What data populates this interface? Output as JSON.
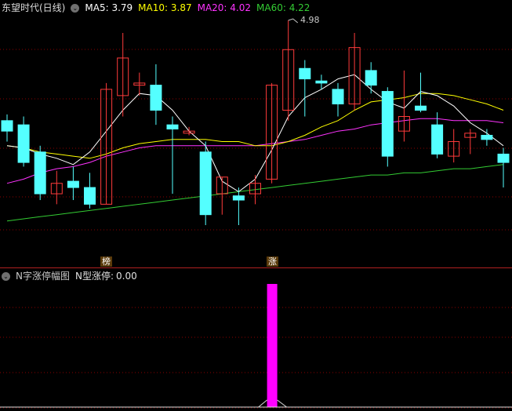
{
  "header": {
    "title": "东望时代(日线)",
    "ma5_label": "MA5:",
    "ma5_value": "3.79",
    "ma10_label": "MA10:",
    "ma10_value": "3.87",
    "ma20_label": "MA20:",
    "ma20_value": "4.02",
    "ma60_label": "MA60:",
    "ma60_value": "4.22"
  },
  "indicator": {
    "title": "N字涨停幅图",
    "value_label": "N型涨停:",
    "value": "0.00"
  },
  "annotations": {
    "high_price": "4.98",
    "badge_bang": "榜",
    "badge_zhang": "涨"
  },
  "colors": {
    "up": "#ff3b3b",
    "down": "#54ffff",
    "ma5": "#ffffff",
    "ma10": "#ffff00",
    "ma20": "#ff33ff",
    "ma60": "#33cc33",
    "bar": "#ff00ff",
    "grid": "#8b0000",
    "divider": "#b02020"
  },
  "chart_data": [
    {
      "type": "candlestick",
      "title": "东望时代(日线)",
      "candles": [
        {
          "o": 4.5,
          "h": 4.53,
          "l": 4.4,
          "c": 4.45
        },
        {
          "o": 4.48,
          "h": 4.52,
          "l": 4.28,
          "c": 4.3
        },
        {
          "o": 4.35,
          "h": 4.38,
          "l": 4.12,
          "c": 4.15
        },
        {
          "o": 4.15,
          "h": 4.26,
          "l": 4.1,
          "c": 4.2
        },
        {
          "o": 4.21,
          "h": 4.28,
          "l": 4.12,
          "c": 4.18
        },
        {
          "o": 4.18,
          "h": 4.25,
          "l": 4.08,
          "c": 4.1
        },
        {
          "o": 4.1,
          "h": 4.68,
          "l": 4.1,
          "c": 4.65
        },
        {
          "o": 4.62,
          "h": 4.92,
          "l": 4.52,
          "c": 4.8
        },
        {
          "o": 4.67,
          "h": 4.73,
          "l": 4.62,
          "c": 4.68
        },
        {
          "o": 4.67,
          "h": 4.77,
          "l": 4.48,
          "c": 4.55
        },
        {
          "o": 4.48,
          "h": 4.52,
          "l": 4.15,
          "c": 4.46
        },
        {
          "o": 4.44,
          "h": 4.47,
          "l": 4.43,
          "c": 4.45
        },
        {
          "o": 4.35,
          "h": 4.4,
          "l": 4.0,
          "c": 4.05
        },
        {
          "o": 4.15,
          "h": 4.23,
          "l": 4.05,
          "c": 4.23
        },
        {
          "o": 4.14,
          "h": 4.18,
          "l": 4.0,
          "c": 4.12
        },
        {
          "o": 4.15,
          "h": 4.24,
          "l": 4.1,
          "c": 4.2
        },
        {
          "o": 4.22,
          "h": 4.68,
          "l": 4.2,
          "c": 4.67
        },
        {
          "o": 4.55,
          "h": 4.98,
          "l": 4.5,
          "c": 4.84
        },
        {
          "o": 4.75,
          "h": 4.79,
          "l": 4.52,
          "c": 4.7
        },
        {
          "o": 4.69,
          "h": 4.72,
          "l": 4.65,
          "c": 4.68
        },
        {
          "o": 4.65,
          "h": 4.68,
          "l": 4.52,
          "c": 4.58
        },
        {
          "o": 4.58,
          "h": 4.92,
          "l": 4.55,
          "c": 4.85
        },
        {
          "o": 4.74,
          "h": 4.78,
          "l": 4.63,
          "c": 4.67
        },
        {
          "o": 4.64,
          "h": 4.66,
          "l": 4.28,
          "c": 4.33
        },
        {
          "o": 4.45,
          "h": 4.74,
          "l": 4.4,
          "c": 4.52
        },
        {
          "o": 4.57,
          "h": 4.73,
          "l": 4.54,
          "c": 4.55
        },
        {
          "o": 4.48,
          "h": 4.54,
          "l": 4.32,
          "c": 4.34
        },
        {
          "o": 4.33,
          "h": 4.46,
          "l": 4.3,
          "c": 4.4
        },
        {
          "o": 4.42,
          "h": 4.46,
          "l": 4.34,
          "c": 4.44
        },
        {
          "o": 4.43,
          "h": 4.46,
          "l": 4.38,
          "c": 4.41
        },
        {
          "o": 4.34,
          "h": 4.37,
          "l": 4.18,
          "c": 4.3
        }
      ],
      "ma5": [
        4.38,
        4.37,
        4.34,
        4.32,
        4.29,
        4.35,
        4.45,
        4.55,
        4.63,
        4.62,
        4.55,
        4.45,
        4.38,
        4.21,
        4.16,
        4.22,
        4.36,
        4.52,
        4.61,
        4.65,
        4.7,
        4.72,
        4.65,
        4.59,
        4.56,
        4.64,
        4.62,
        4.57,
        4.49,
        4.44,
        4.38
      ],
      "ma10": [
        4.38,
        4.37,
        4.35,
        4.34,
        4.33,
        4.32,
        4.34,
        4.37,
        4.39,
        4.4,
        4.41,
        4.41,
        4.41,
        4.4,
        4.4,
        4.38,
        4.38,
        4.4,
        4.43,
        4.47,
        4.5,
        4.55,
        4.59,
        4.6,
        4.61,
        4.63,
        4.63,
        4.62,
        4.6,
        4.58,
        4.55
      ],
      "ma20": [
        4.2,
        4.22,
        4.25,
        4.27,
        4.28,
        4.3,
        4.33,
        4.35,
        4.37,
        4.38,
        4.38,
        4.38,
        4.38,
        4.38,
        4.38,
        4.38,
        4.39,
        4.4,
        4.41,
        4.43,
        4.45,
        4.46,
        4.48,
        4.49,
        4.5,
        4.51,
        4.51,
        4.5,
        4.5,
        4.5,
        4.49
      ],
      "ma60": [
        4.02,
        4.03,
        4.04,
        4.05,
        4.06,
        4.07,
        4.08,
        4.09,
        4.1,
        4.11,
        4.12,
        4.13,
        4.14,
        4.15,
        4.16,
        4.17,
        4.18,
        4.19,
        4.2,
        4.21,
        4.22,
        4.23,
        4.24,
        4.24,
        4.25,
        4.25,
        4.26,
        4.27,
        4.27,
        4.28,
        4.29
      ]
    },
    {
      "type": "bar",
      "title": "N字涨停幅图",
      "series": [
        {
          "name": "N型涨停",
          "values": [
            0,
            0,
            0,
            0,
            0,
            0,
            0,
            0,
            0,
            0,
            0,
            0,
            0,
            0,
            0,
            0,
            1,
            0,
            0,
            0,
            0,
            0,
            0,
            0,
            0,
            0,
            0,
            0,
            0,
            0,
            0
          ]
        }
      ]
    }
  ]
}
